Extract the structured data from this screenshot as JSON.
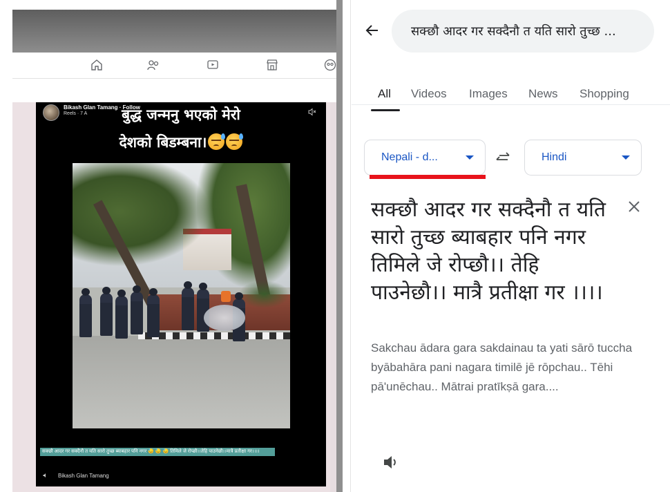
{
  "facebook_reel": {
    "author": "Bikash Glan Tamang · Follow",
    "sub": "Reels · 7 A",
    "title_line1": "बुद्ध जन्मनु भएको मेरो",
    "title_line2": "देशको बिडम्बना।",
    "caption": "सक्छौ आदर गर सक्दैनौ त यति सारो तुच्छ ब्याबहार पनि नगर 😓 😓 😓 तिमिले जे रोप्छौ।।तेहि पाउनेछौ।।मात्रै प्रतीक्षा गर।।।।",
    "footer_author": "Bikash Glan Tamang",
    "nav_icons": [
      "home-icon",
      "friends-icon",
      "video-icon",
      "marketplace-icon",
      "groups-icon"
    ],
    "emoji": "sad-sweat-emoji"
  },
  "translate": {
    "search_query": "सक्छौ आदर गर सक्दैनौ त यति सारो तुच्छ ...",
    "tabs": [
      {
        "label": "All",
        "active": true
      },
      {
        "label": "Videos",
        "active": false
      },
      {
        "label": "Images",
        "active": false
      },
      {
        "label": "News",
        "active": false
      },
      {
        "label": "Shopping",
        "active": false
      }
    ],
    "source_language": "Nepali - d...",
    "target_language": "Hindi",
    "source_text": "सक्छौ आदर गर सक्दैनौ त यति सारो तुच्छ ब्याबहार पनि नगर तिमिले जे रोप्छौ।। तेहि पाउनेछौ।। मात्रै प्रतीक्षा गर ।।।।",
    "transliteration": "Sakchau ādara gara sakdainau ta yati sārō tuccha byābahāra pani nagara timilē jē rōpchau.. Tēhi pā'unēchau.. Mātrai pratīkṣā gara....",
    "icons": {
      "back": "arrow-left-icon",
      "swap": "swap-languages-icon",
      "clear": "close-icon",
      "listen": "speaker-icon"
    },
    "accent_color": "#1a56c4",
    "annotation_color": "#e8131b"
  }
}
